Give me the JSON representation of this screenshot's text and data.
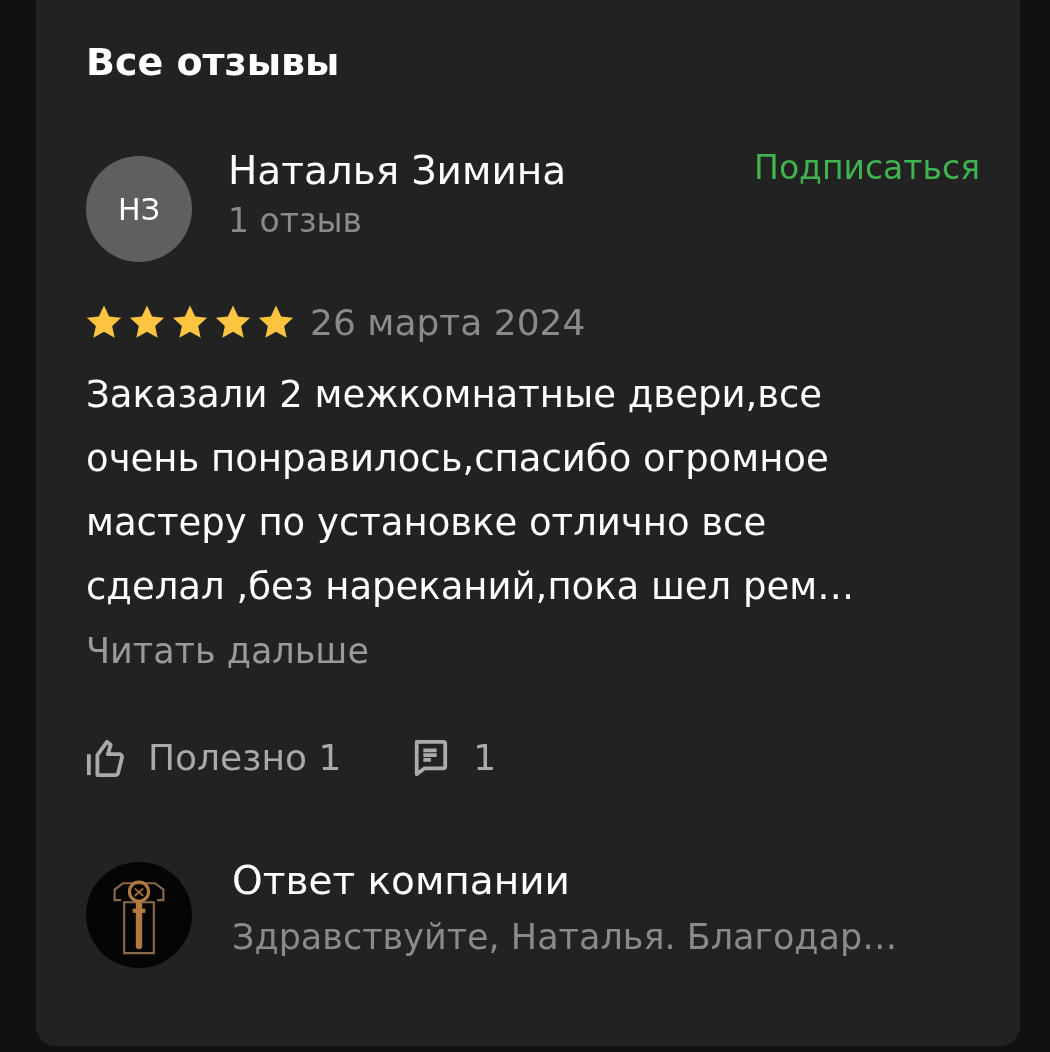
{
  "title": "Все отзывы",
  "review": {
    "avatar_initials": "НЗ",
    "author": "Наталья Зимина",
    "subscribe": "Подписаться",
    "author_reviews": "1 отзыв",
    "stars": 5,
    "date": "26 марта 2024",
    "text": "Заказали 2 межкомнатные двери,все\nочень понравилось,спасибо огромное\nмастеру по установке отлично все\nсделал ,без нареканий,пока шел рем…",
    "read_more": "Читать дальше",
    "useful": "Полезно 1",
    "comments": "1"
  },
  "company_reply": {
    "title": "Ответ компании",
    "text": "Здравствуйте, Наталья. Благодар…"
  }
}
